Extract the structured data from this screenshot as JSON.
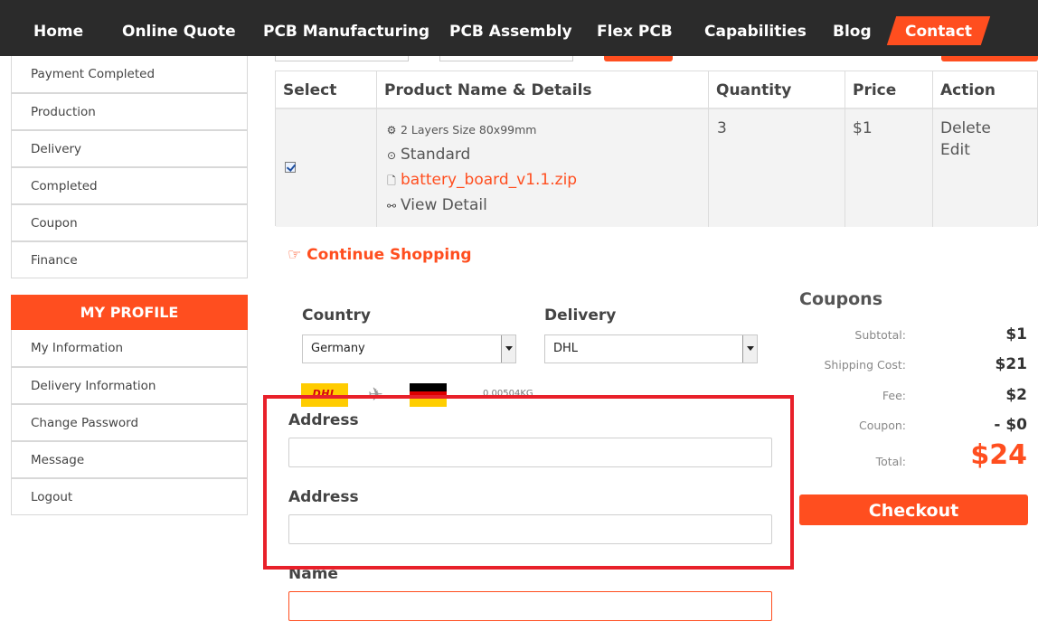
{
  "nav": {
    "items": [
      "Home",
      "Online Quote",
      "PCB Manufacturing",
      "PCB Assembly",
      "Flex PCB",
      "Capabilities",
      "Blog"
    ],
    "contact": "Contact",
    "colors": {
      "bar": "#2b2b2b",
      "accent": "#ff4e1f"
    }
  },
  "sidebar": {
    "orders": [
      "Payment Completed",
      "Production",
      "Delivery",
      "Completed",
      "Coupon",
      "Finance"
    ],
    "profile_heading": "MY PROFILE",
    "profile": [
      "My Information",
      "Delivery Information",
      "Change Password",
      "Message",
      "Logout"
    ]
  },
  "table": {
    "headers": [
      "Select",
      "Product Name & Details",
      "Quantity",
      "Price",
      "Action"
    ],
    "row": {
      "checked": true,
      "spec": "2 Layers Size 80x99mm",
      "build_time": "Standard",
      "file": "battery_board_v1.1.zip",
      "view_detail": "View Detail",
      "quantity": "3",
      "price": "$1",
      "action_delete": "Delete",
      "action_edit": "Edit"
    }
  },
  "continue_shopping": "Continue Shopping",
  "shipping": {
    "country_label": "Country",
    "country_value": "Germany",
    "delivery_label": "Delivery",
    "delivery_value": "DHL",
    "carrier_logo_text": "DHL",
    "weight": "0.00504KG"
  },
  "form": {
    "address1_label": "Address",
    "address2_label": "Address",
    "name_label": "Name"
  },
  "summary": {
    "title": "Coupons",
    "subtotal_label": "Subtotal:",
    "subtotal_value": "$1",
    "shipping_label": "Shipping Cost:",
    "shipping_value": "$21",
    "fee_label": "Fee:",
    "fee_value": "$2",
    "coupon_label": "Coupon:",
    "coupon_value": "- $0",
    "total_label": "Total:",
    "total_value": "$24",
    "checkout": "Checkout"
  }
}
